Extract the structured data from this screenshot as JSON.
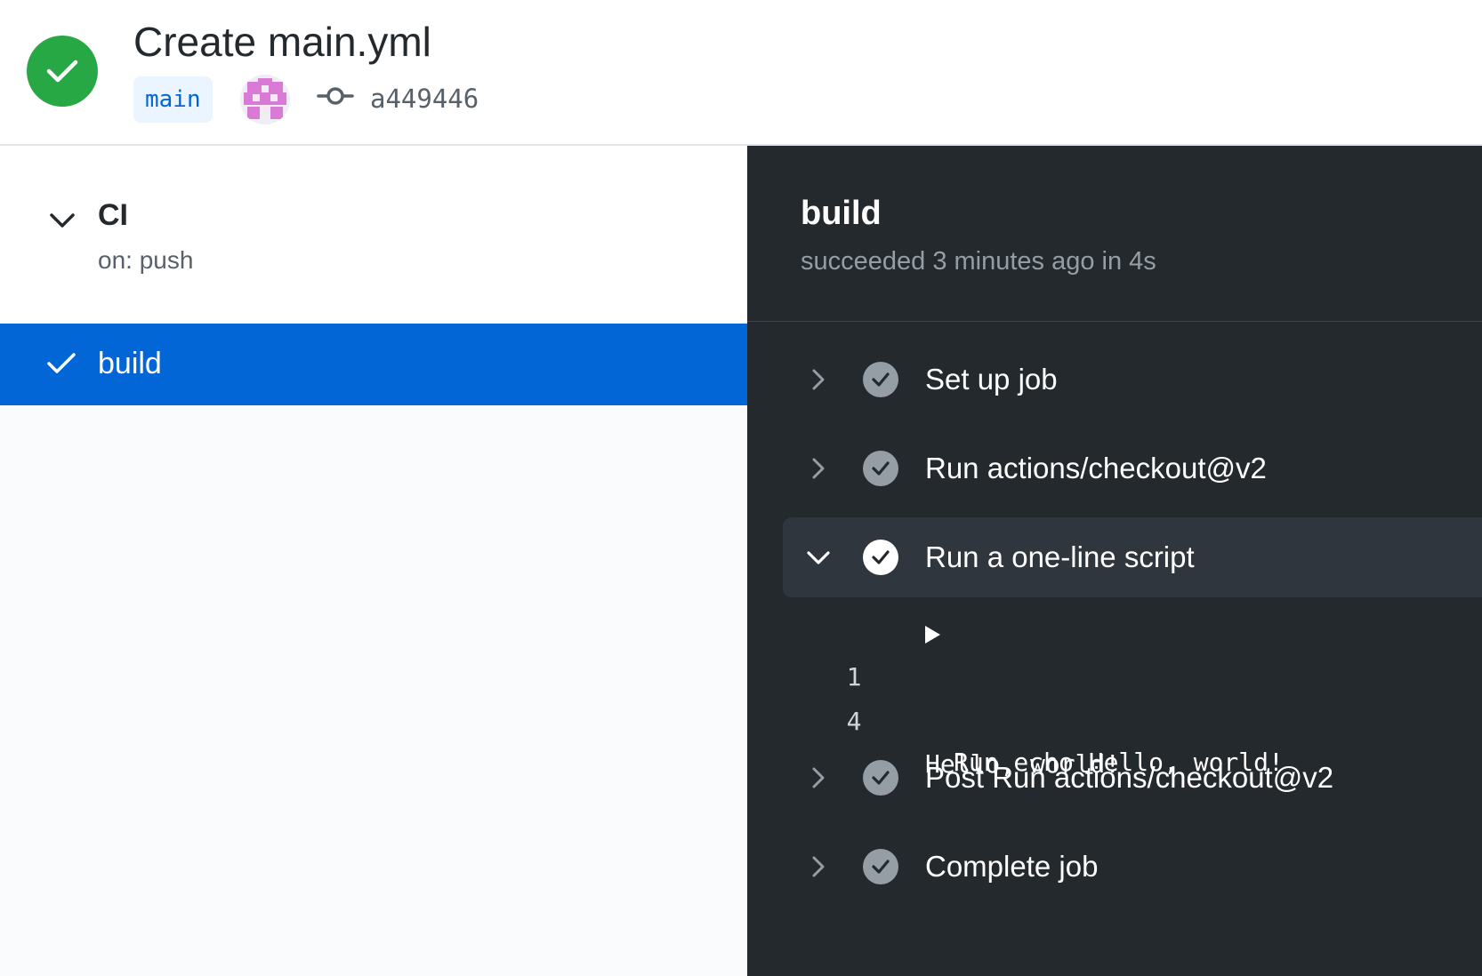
{
  "header": {
    "title": "Create main.yml",
    "branch": "main",
    "commit_sha": "a449446",
    "status": "success",
    "status_color": "#28a745"
  },
  "workflow": {
    "name": "CI",
    "trigger": "on: push",
    "expand_icon": "chevron-down-icon"
  },
  "jobs": [
    {
      "label": "build",
      "status": "success",
      "selected": true,
      "accent": "#0366d6"
    }
  ],
  "job_detail": {
    "title": "build",
    "subtitle": "succeeded 3 minutes ago in 4s",
    "steps": [
      {
        "label": "Set up job",
        "expanded": false
      },
      {
        "label": "Run actions/checkout@v2",
        "expanded": false
      },
      {
        "label": "Run a one-line script",
        "expanded": true,
        "log": [
          {
            "line": "1",
            "text": "Run echo Hello, world!",
            "collapsible": true
          },
          {
            "line": "4",
            "text": "Hello, world!",
            "collapsible": false
          }
        ]
      },
      {
        "label": "Post Run actions/checkout@v2",
        "expanded": false
      },
      {
        "label": "Complete job",
        "expanded": false
      }
    ]
  }
}
